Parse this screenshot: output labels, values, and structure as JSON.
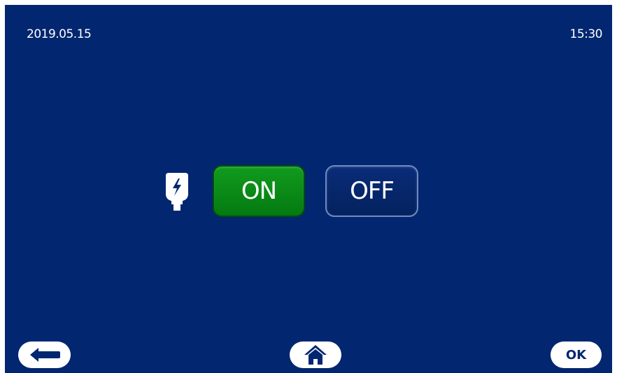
{
  "status_bar": {
    "date": "2019.05.15",
    "time": "15:30"
  },
  "charging": {
    "icon": "charger-plug-icon",
    "on_label": "ON",
    "off_label": "OFF",
    "selected": "ON"
  },
  "nav": {
    "back_icon": "arrow-left-icon",
    "home_icon": "home-icon",
    "ok_label": "OK"
  },
  "colors": {
    "background": "#022670",
    "on_button": "#0c8c19",
    "off_button": "#062665",
    "nav_button": "#ffffff"
  }
}
